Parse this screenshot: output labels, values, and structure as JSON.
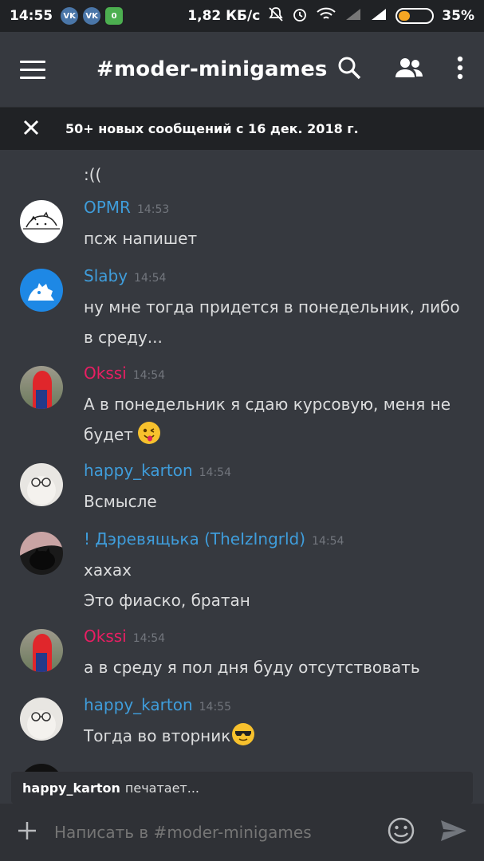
{
  "status_bar": {
    "time": "14:55",
    "apps": [
      "VK",
      "VK",
      "0"
    ],
    "network_speed": "1,82 КБ/с",
    "battery_percent": "35%",
    "battery_level": 0.35
  },
  "header": {
    "channel": "#moder-minigames"
  },
  "banner": {
    "text": "50+ новых сообщений с 16 дек. 2018 г."
  },
  "messages": [
    {
      "lines": [
        ":(("
      ]
    },
    {
      "author": "OPMR",
      "color": "#3f9ddb",
      "time": "14:53",
      "lines": [
        "псж напишет"
      ]
    },
    {
      "author": "Slaby",
      "color": "#3f9ddb",
      "time": "14:54",
      "lines": [
        "ну мне тогда придется в понедельник, либо в среду..."
      ]
    },
    {
      "author": "Okssi",
      "color": "#e91e63",
      "time": "14:54",
      "lines": [
        "А в понедельник я сдаю курсовую, меня не будет"
      ]
    },
    {
      "author": "happy_karton",
      "color": "#3f9ddb",
      "time": "14:54",
      "lines": [
        "Всмысле"
      ]
    },
    {
      "author": "! Дэревящька (TheIzIngrld)",
      "color": "#3f9ddb",
      "time": "14:54",
      "lines": [
        "хахах",
        "Это фиаско, братан"
      ]
    },
    {
      "author": "Okssi",
      "color": "#e91e63",
      "time": "14:54",
      "lines": [
        "а в среду я пол дня буду отсутствовать"
      ]
    },
    {
      "author": "happy_karton",
      "color": "#3f9ddb",
      "time": "14:55",
      "lines": [
        "Тогда во вторник"
      ]
    }
  ],
  "typing": {
    "user": "happy_karton",
    "text": "печатает..."
  },
  "composer": {
    "placeholder": "Написать в #moder-minigames"
  }
}
